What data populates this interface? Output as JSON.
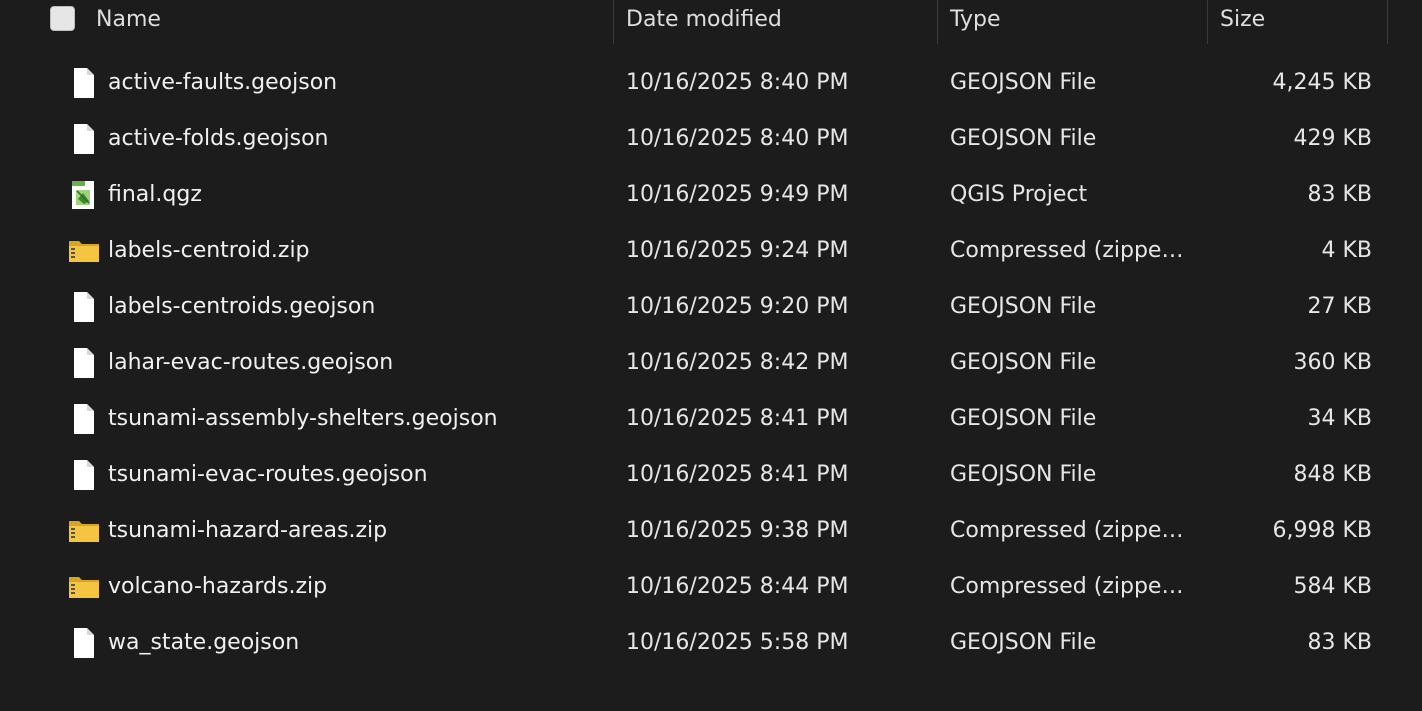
{
  "header": {
    "name_label": "Name",
    "date_label": "Date modified",
    "type_label": "Type",
    "size_label": "Size"
  },
  "files": [
    {
      "name": "active-faults.geojson",
      "date": "10/16/2025 8:40 PM",
      "type": "GEOJSON File",
      "size": "4,245 KB",
      "icon": "document-icon"
    },
    {
      "name": "active-folds.geojson",
      "date": "10/16/2025 8:40 PM",
      "type": "GEOJSON File",
      "size": "429 KB",
      "icon": "document-icon"
    },
    {
      "name": "final.qgz",
      "date": "10/16/2025 9:49 PM",
      "type": "QGIS Project",
      "size": "83 KB",
      "icon": "qgis-project-icon"
    },
    {
      "name": "labels-centroid.zip",
      "date": "10/16/2025 9:24 PM",
      "type": "Compressed (zipped)...",
      "size": "4 KB",
      "icon": "zip-folder-icon"
    },
    {
      "name": "labels-centroids.geojson",
      "date": "10/16/2025 9:20 PM",
      "type": "GEOJSON File",
      "size": "27 KB",
      "icon": "document-icon"
    },
    {
      "name": "lahar-evac-routes.geojson",
      "date": "10/16/2025 8:42 PM",
      "type": "GEOJSON File",
      "size": "360 KB",
      "icon": "document-icon"
    },
    {
      "name": "tsunami-assembly-shelters.geojson",
      "date": "10/16/2025 8:41 PM",
      "type": "GEOJSON File",
      "size": "34 KB",
      "icon": "document-icon"
    },
    {
      "name": "tsunami-evac-routes.geojson",
      "date": "10/16/2025 8:41 PM",
      "type": "GEOJSON File",
      "size": "848 KB",
      "icon": "document-icon"
    },
    {
      "name": "tsunami-hazard-areas.zip",
      "date": "10/16/2025 9:38 PM",
      "type": "Compressed (zipped)...",
      "size": "6,998 KB",
      "icon": "zip-folder-icon"
    },
    {
      "name": "volcano-hazards.zip",
      "date": "10/16/2025 8:44 PM",
      "type": "Compressed (zipped)...",
      "size": "584 KB",
      "icon": "zip-folder-icon"
    },
    {
      "name": "wa_state.geojson",
      "date": "10/16/2025 5:58 PM",
      "type": "GEOJSON File",
      "size": "83 KB",
      "icon": "document-icon"
    }
  ],
  "colors": {
    "background": "#1c1c1c",
    "folder_yellow": "#f5c542",
    "qgis_green": "#6ab04c"
  }
}
